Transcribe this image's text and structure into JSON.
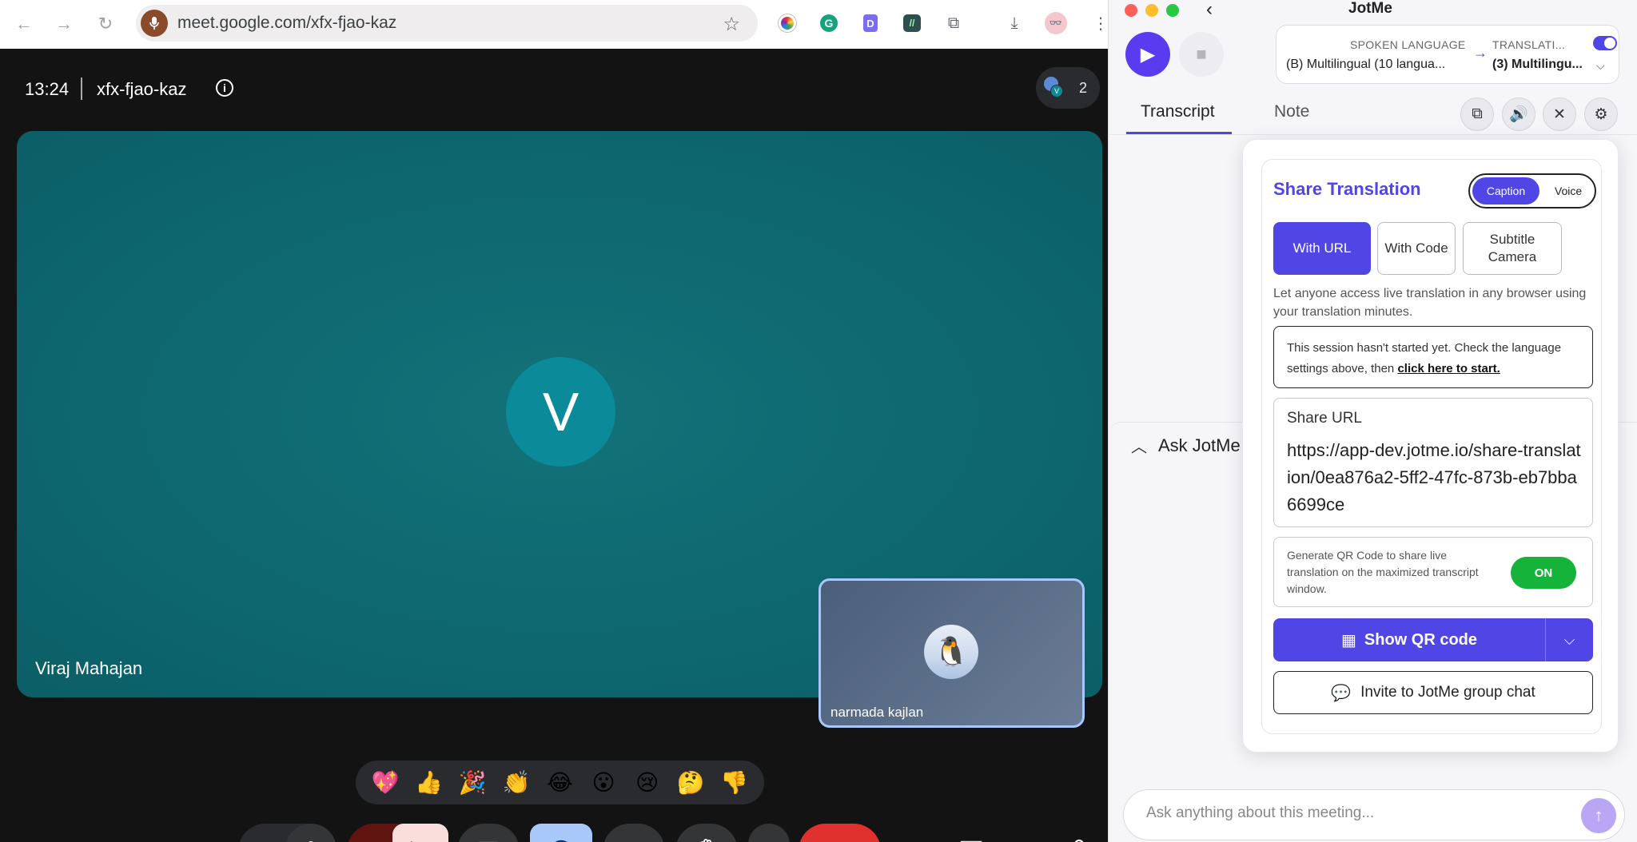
{
  "browser": {
    "url": "meet.google.com/xfx-fjao-kaz"
  },
  "meet": {
    "time": "13:24",
    "meeting_code": "xfx-fjao-kaz",
    "participant_count": "2",
    "main_avatar_initial": "V",
    "main_participant_name": "Viraj Mahajan",
    "pip_participant_name": "narmada kajlan",
    "reactions": [
      "💖",
      "👍",
      "🎉",
      "👏",
      "😂",
      "😮",
      "😢",
      "🤔",
      "👎"
    ],
    "colors": {
      "end_call": "#e0312e",
      "avatar": "#0b8a99",
      "reactions_active": "#a8c7fa"
    }
  },
  "jotme": {
    "title": "JotMe",
    "spoken_language_label": "SPOKEN LANGUAGE",
    "spoken_language_value": "(B) Multilingual (10 langua...",
    "translation_label": "TRANSLATI...",
    "translation_value": "(3) Multilingu...",
    "tabs": [
      "Transcript",
      "Note"
    ],
    "ask_label": "Ask JotMe",
    "ask_placeholder": "Ask anything about this meeting...",
    "accent": "#4f46e5",
    "share": {
      "title": "Share Translation",
      "segment_on": "Caption",
      "segment_off": "Voice",
      "mode_url": "With URL",
      "mode_code": "With Code",
      "mode_subtitle_line1": "Subtitle",
      "mode_subtitle_line2": "Camera",
      "description": "Let anyone access live translation in any browser using your translation minutes.",
      "notice_text": "This session hasn't started yet. Check the language settings above, then ",
      "notice_link": "click here to start.",
      "url_label": "Share URL",
      "url_value": "https://app-dev.jotme.io/share-translation/0ea876a2-5ff2-47fc-873b-eb7bba6699ce",
      "qr_description": "Generate QR Code to share live translation on the maximized transcript window.",
      "qr_toggle": "ON",
      "show_qr": "Show QR code",
      "invite": "Invite to JotMe group chat"
    }
  }
}
